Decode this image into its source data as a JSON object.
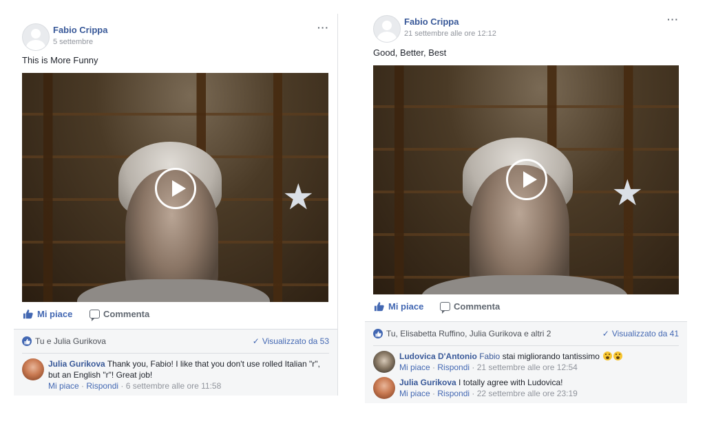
{
  "colors": {
    "link": "#385898",
    "accent": "#4267b2",
    "muted": "#90949c",
    "footer_bg": "#f5f6f7"
  },
  "posts": [
    {
      "author": "Fabio Crippa",
      "date": "5 settembre",
      "text": "This is More Funny",
      "more": "···",
      "like_label": "Mi piace",
      "comment_label": "Commenta",
      "reactions": "Tu e Julia Gurikova",
      "views": "Visualizzato da 53",
      "comments": [
        {
          "name": "Julia Gurikova",
          "text": "Thank you, Fabio! I like that you don't use rolled Italian \"r\", but an English \"r\"! Great job!",
          "like": "Mi piace",
          "reply": "Rispondi",
          "time": "6 settembre alle ore 11:58",
          "separator": " · "
        }
      ]
    },
    {
      "author": "Fabio Crippa",
      "date": "21 settembre alle ore 12:12",
      "text": "Good, Better, Best",
      "more": "···",
      "like_label": "Mi piace",
      "comment_label": "Commenta",
      "reactions": "Tu, Elisabetta Ruffino, Julia Gurikova e altri 2",
      "views": "Visualizzato da 41",
      "comments": [
        {
          "name": "Ludovica D'Antonio",
          "tag": "Fabio",
          "text": "stai migliorando tantissimo",
          "like": "Mi piace",
          "reply": "Rispondi",
          "time": "21 settembre alle ore 12:54",
          "separator": " · "
        },
        {
          "name": "Julia Gurikova",
          "text": "I totally agree with Ludovica!",
          "like": "Mi piace",
          "reply": "Rispondi",
          "time": "22 settembre alle ore 23:19",
          "separator": " · "
        }
      ]
    }
  ]
}
